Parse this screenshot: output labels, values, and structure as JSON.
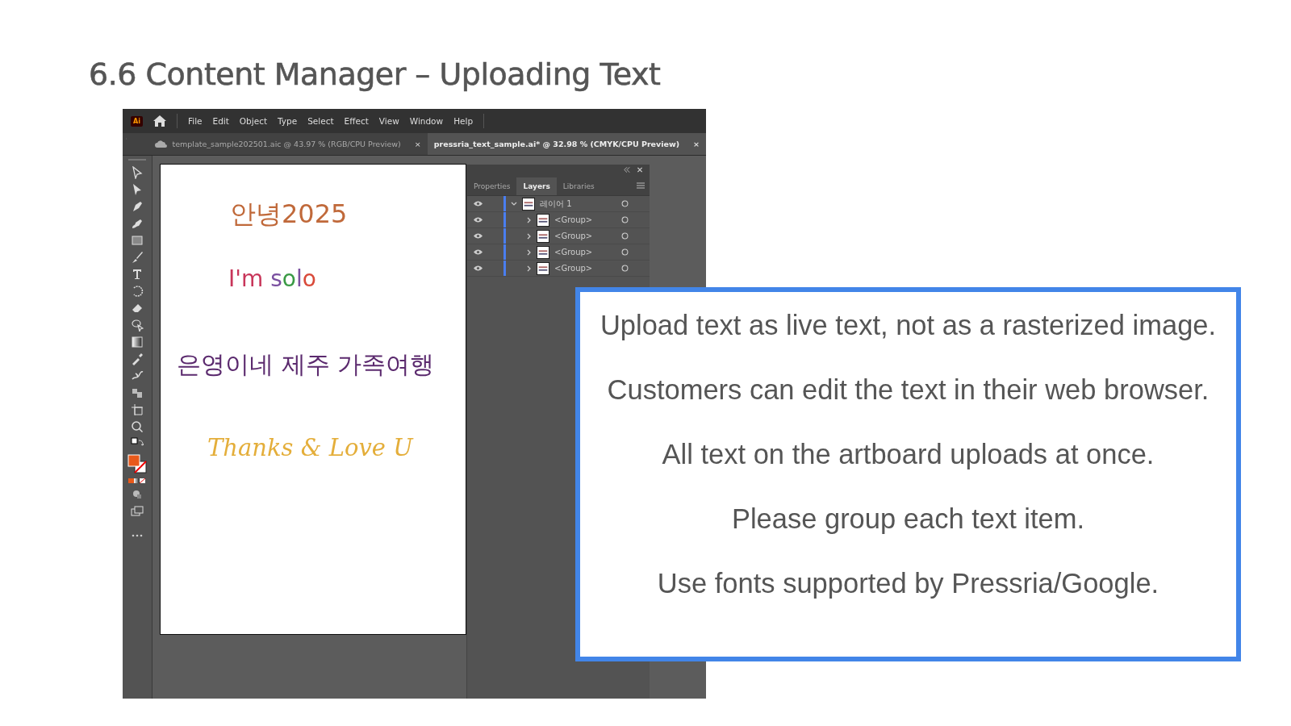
{
  "slide_title": "6.6 Content Manager – Uploading Text",
  "app": {
    "logo": "Ai",
    "menu": [
      "File",
      "Edit",
      "Object",
      "Type",
      "Select",
      "Effect",
      "View",
      "Window",
      "Help"
    ],
    "documents": [
      {
        "title": "template_sample202501.aic @ 43.97 % (RGB/CPU Preview)",
        "close": "×",
        "cloud": true,
        "selected": false
      },
      {
        "title": "pressria_text_sample.ai* @ 32.98 % (CMYK/CPU Preview)",
        "close": "×",
        "cloud": false,
        "selected": true
      }
    ],
    "artboard_texts": [
      {
        "kind": "plain",
        "text": "안녕2025",
        "color": "#c0693a"
      },
      {
        "kind": "multi",
        "segments": [
          {
            "text": "I'm ",
            "color": "#c8365a"
          },
          {
            "text": "s",
            "color": "#7a4fa0"
          },
          {
            "text": "o",
            "color": "#3a9a45"
          },
          {
            "text": "l",
            "color": "#7a4fa0"
          },
          {
            "text": "o",
            "color": "#d94a3a"
          }
        ]
      },
      {
        "kind": "plain",
        "text": "은영이네 제주 가족여행",
        "color": "#5b2a6e"
      },
      {
        "kind": "script",
        "text": "Thanks & Love U",
        "color": "#e4ae3a"
      }
    ],
    "panel": {
      "tabs": [
        {
          "label": "Properties",
          "selected": false
        },
        {
          "label": "Layers",
          "selected": true
        },
        {
          "label": "Libraries",
          "selected": false
        }
      ],
      "layers": [
        {
          "name": "레이어 1",
          "visible": true,
          "expanded": true,
          "children": [
            {
              "name": "<Group>",
              "visible": true,
              "expanded": false
            },
            {
              "name": "<Group>",
              "visible": true,
              "expanded": false
            },
            {
              "name": "<Group>",
              "visible": true,
              "expanded": false
            },
            {
              "name": "<Group>",
              "visible": true,
              "expanded": false
            }
          ]
        }
      ]
    }
  },
  "callout": [
    "Upload text as live text, not as a rasterized image.",
    "Customers can edit the text in their web browser.",
    "All text on the artboard uploads at once.",
    "Please group each text item.",
    "Use fonts supported by Pressria/Google."
  ]
}
